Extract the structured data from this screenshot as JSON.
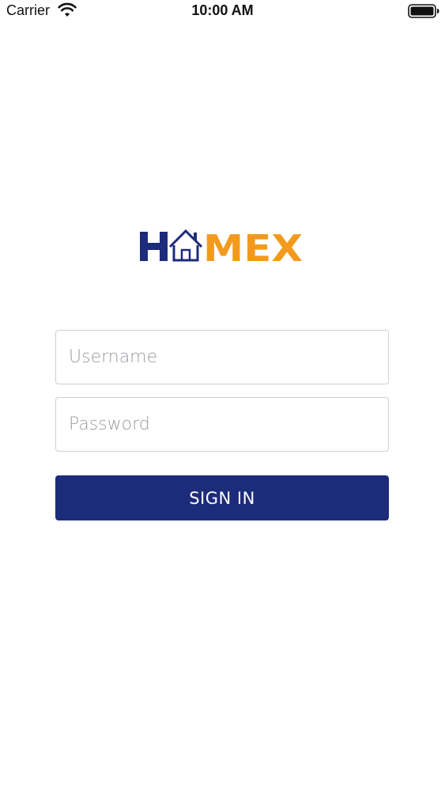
{
  "status_bar": {
    "carrier": "Carrier",
    "time": "10:00 AM",
    "icons": [
      "wifi-icon",
      "battery-icon"
    ]
  },
  "logo": {
    "text": "HOMEX",
    "icon": "house-icon",
    "colors": {
      "primary": "#1c2b7a",
      "accent": "#f39a1e"
    }
  },
  "login_form": {
    "username": {
      "value": "",
      "placeholder": "Username"
    },
    "password": {
      "value": "",
      "placeholder": "Password"
    },
    "submit_label": "SIGN IN"
  },
  "colors": {
    "button_background": "#1c2b7a",
    "button_text": "#ffffff",
    "field_border": "#cfcfd4",
    "placeholder": "#9a9aa2"
  }
}
